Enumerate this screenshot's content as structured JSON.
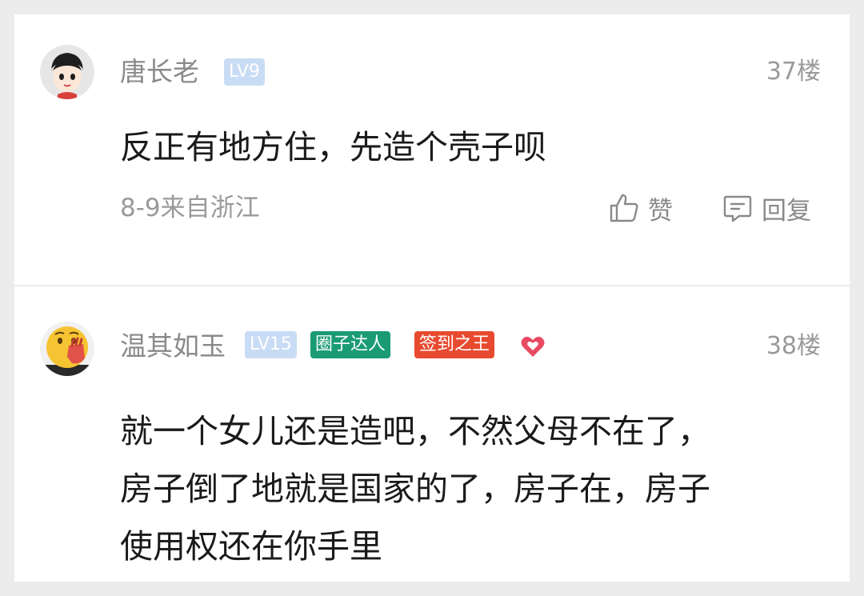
{
  "comments": [
    {
      "username": "唐长老",
      "level": "LV9",
      "badges": [],
      "floor": "37楼",
      "content_lines": [
        "反正有地方住，先造个壳子呗"
      ],
      "meta": "8-9来自浙江",
      "like_label": "赞",
      "reply_label": "回复",
      "avatar_icon": "cartoon-face-avatar"
    },
    {
      "username": "温其如玉",
      "level": "LV15",
      "badges": [
        "圈子达人",
        "签到之王"
      ],
      "floor": "38楼",
      "content_lines": [
        "就一个女儿还是造吧，不然父母不在了，",
        "房子倒了地就是国家的了，房子在，房子",
        "使用权还在你手里"
      ],
      "avatar_icon": "emoji-face-avatar"
    }
  ],
  "colors": {
    "level_badge": "#c9dcf5",
    "circle_expert_badge": "#1a9b73",
    "checkin_king_badge": "#e84a2f",
    "heart": "#e84a62"
  }
}
